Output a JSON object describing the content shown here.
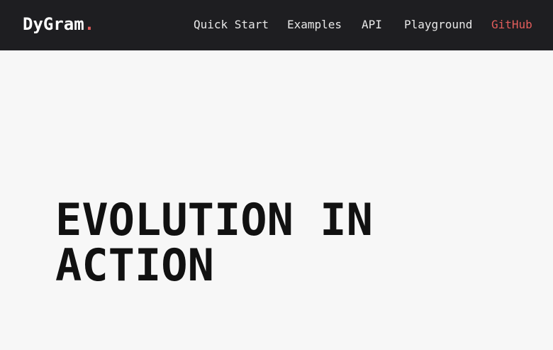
{
  "header": {
    "logo_text": "DyGram",
    "logo_dot": ".",
    "nav": [
      {
        "label": "Quick Start"
      },
      {
        "label": "Examples"
      },
      {
        "label": "API"
      },
      {
        "label": "Playground"
      },
      {
        "label": "GitHub"
      }
    ]
  },
  "hero": {
    "line1": "EVOLUTION IN",
    "line2": "ACTION"
  },
  "colors": {
    "nav_background": "#1e1e21",
    "page_background": "#f7f7f7",
    "accent": "#e35d5b",
    "hero_text": "#111111"
  }
}
